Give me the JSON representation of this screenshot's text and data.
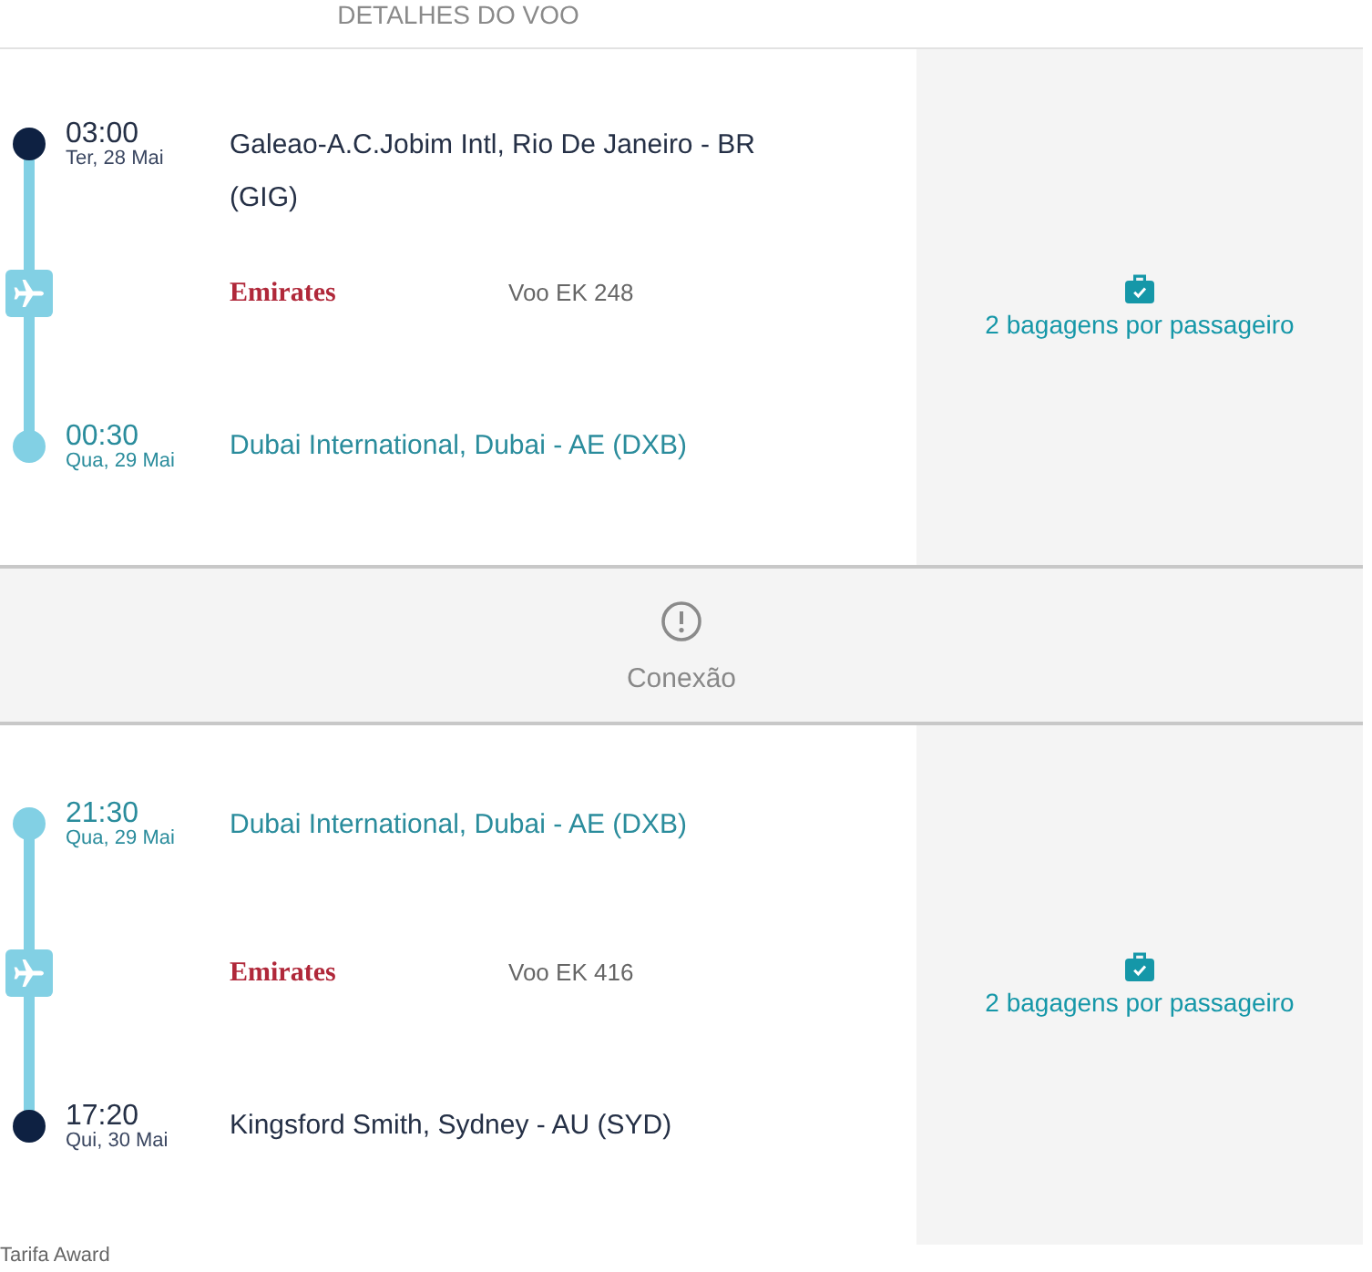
{
  "header": {
    "title": "DETALHES DO VOO"
  },
  "itinerary": [
    {
      "kind": "segment",
      "departure": {
        "time": "03:00",
        "date": "Ter, 28 Mai",
        "airport": "Galeao-A.C.Jobim Intl, Rio De Janeiro - BR (GIG)",
        "connection": false
      },
      "airline": "Emirates",
      "flight": "Voo EK 248",
      "arrival": {
        "time": "00:30",
        "date": "Qua, 29 Mai",
        "airport": "Dubai International, Dubai - AE (DXB)",
        "connection": true
      },
      "baggage": "2 bagagens por passageiro"
    },
    {
      "kind": "connection",
      "label": "Conexão"
    },
    {
      "kind": "segment",
      "departure": {
        "time": "21:30",
        "date": "Qua, 29 Mai",
        "airport": "Dubai International, Dubai - AE (DXB)",
        "connection": true
      },
      "airline": "Emirates",
      "flight": "Voo EK 416",
      "arrival": {
        "time": "17:20",
        "date": "Qui, 30 Mai",
        "airport": "Kingsford Smith, Sydney - AU (SYD)",
        "connection": false
      },
      "baggage": "2 bagagens por passageiro"
    }
  ],
  "fare": "Tarifa Award"
}
